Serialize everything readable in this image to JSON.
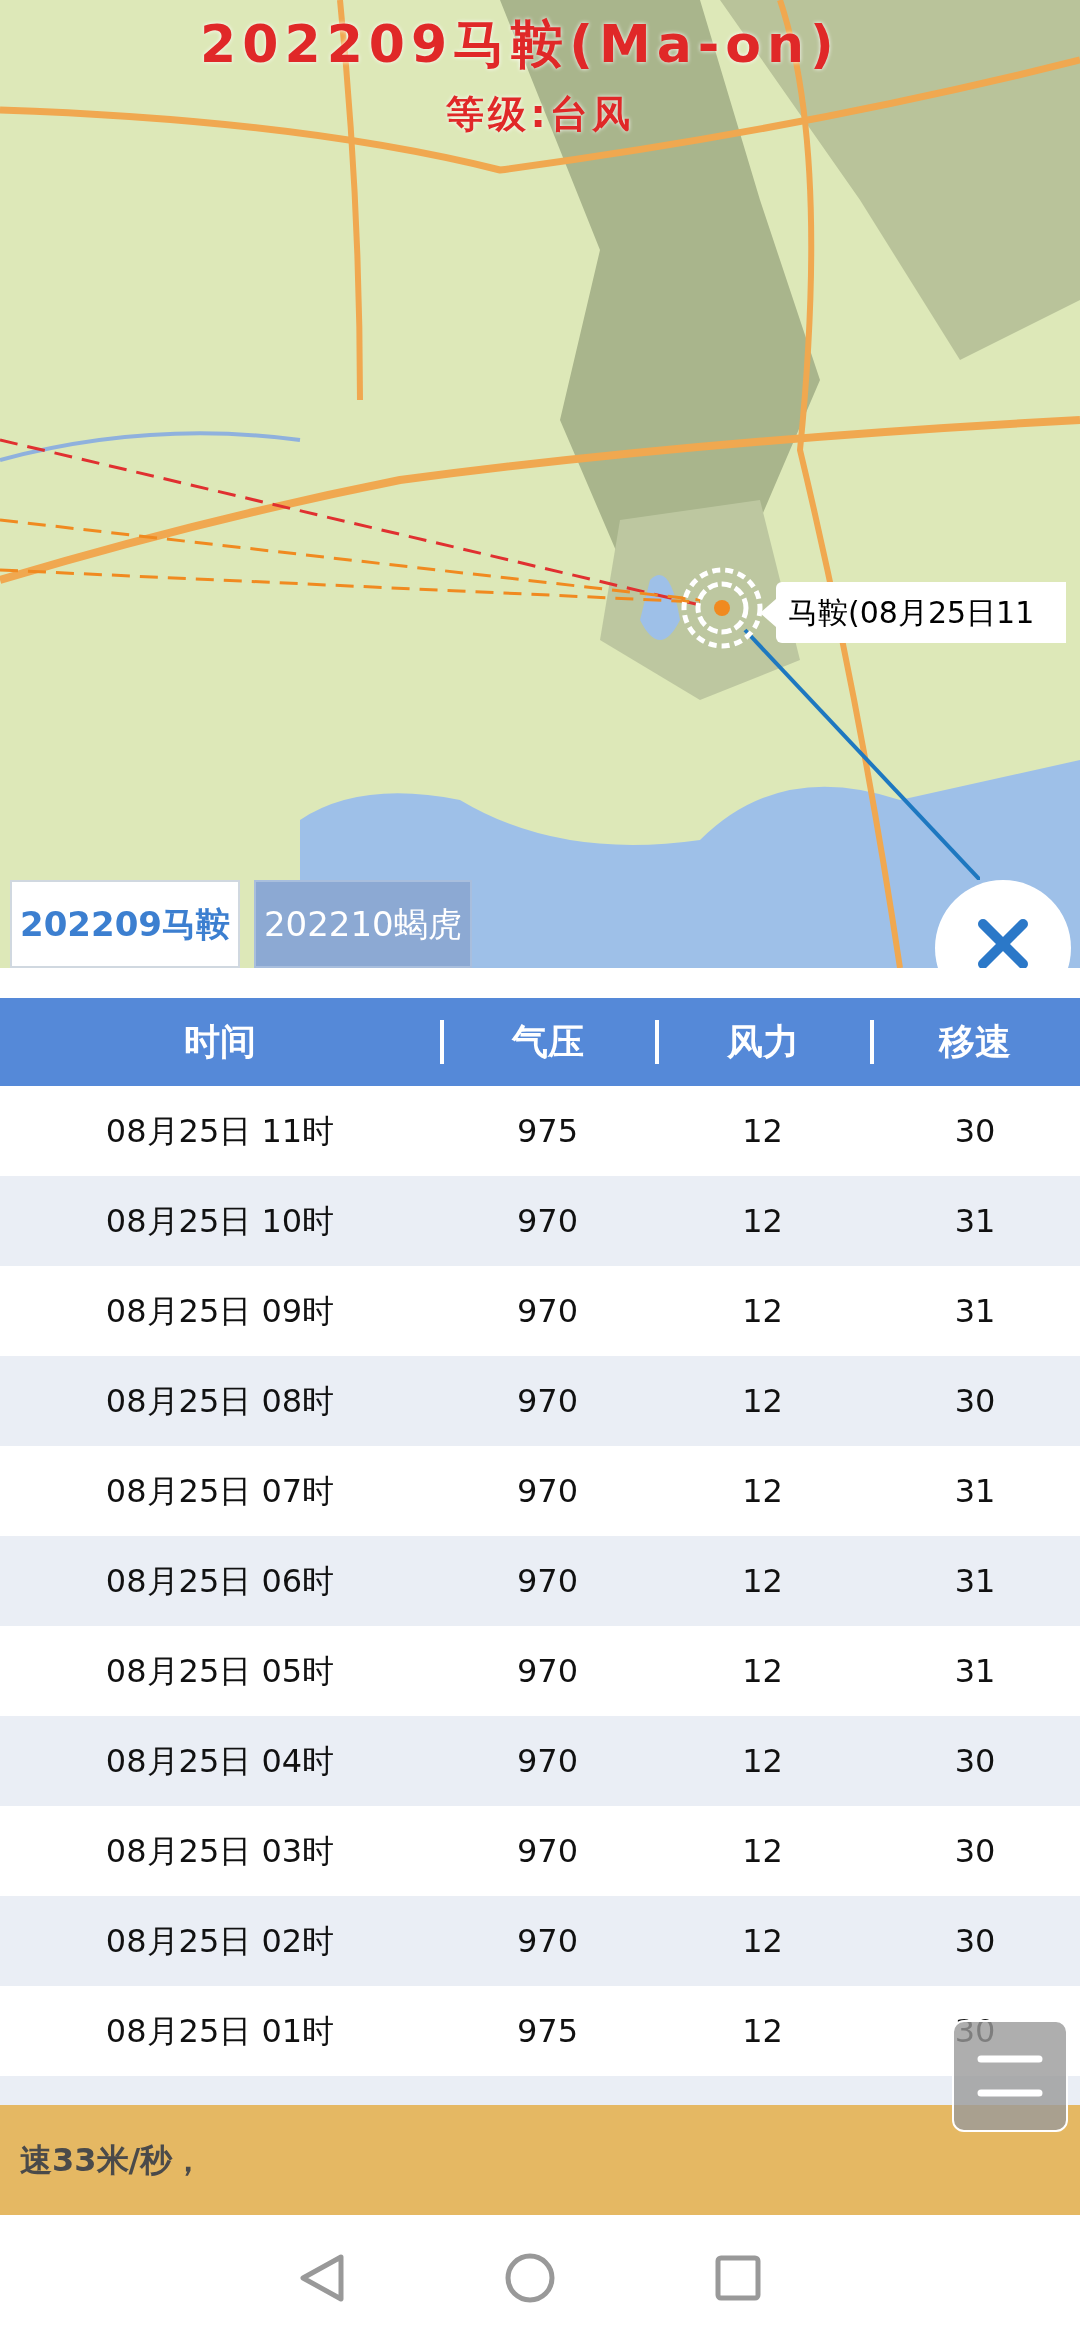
{
  "map": {
    "title": "202209马鞍(Ma-on)",
    "grade": "等级:台风",
    "typhoon_label": "马鞍(08月25日11"
  },
  "tabs": [
    {
      "label": "202209马鞍",
      "selected": true
    },
    {
      "label": "202210蝎虎",
      "selected": false
    }
  ],
  "table": {
    "columns": [
      "时间",
      "气压",
      "风力",
      "移速"
    ],
    "rows": [
      [
        "08月25日 11时",
        "975",
        "12",
        "30"
      ],
      [
        "08月25日 10时",
        "970",
        "12",
        "31"
      ],
      [
        "08月25日 09时",
        "970",
        "12",
        "31"
      ],
      [
        "08月25日 08时",
        "970",
        "12",
        "30"
      ],
      [
        "08月25日 07时",
        "970",
        "12",
        "31"
      ],
      [
        "08月25日 06时",
        "970",
        "12",
        "31"
      ],
      [
        "08月25日 05时",
        "970",
        "12",
        "31"
      ],
      [
        "08月25日 04时",
        "970",
        "12",
        "30"
      ],
      [
        "08月25日 03时",
        "970",
        "12",
        "30"
      ],
      [
        "08月25日 02时",
        "970",
        "12",
        "30"
      ],
      [
        "08月25日 01时",
        "975",
        "12",
        "30"
      ]
    ]
  },
  "banner": "速33米/秒，"
}
